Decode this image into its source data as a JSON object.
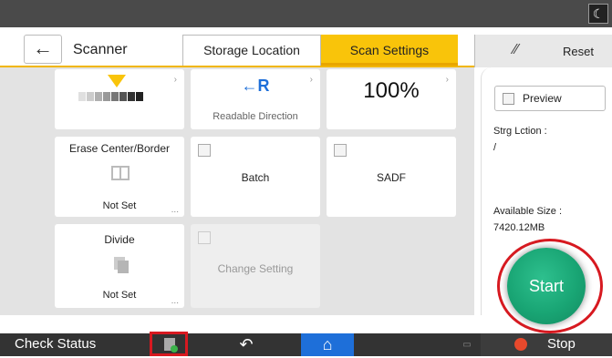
{
  "header": {
    "title": "Scanner",
    "back_icon": "←",
    "tabs": [
      {
        "label": "Storage Location",
        "active": false
      },
      {
        "label": "Scan Settings",
        "active": true
      }
    ],
    "reset_label": "Reset",
    "night_mode_icon": "☾"
  },
  "settings": {
    "density_chevron": "›",
    "readable_direction": {
      "icon_text": "←R",
      "label": "Readable Direction"
    },
    "scale": {
      "value": "100%"
    },
    "erase": {
      "label": "Erase Center/Border",
      "value": "Not Set"
    },
    "batch": {
      "label": "Batch"
    },
    "sadf": {
      "label": "SADF"
    },
    "divide": {
      "label": "Divide",
      "value": "Not Set"
    },
    "change_setting": {
      "label": "Change Setting"
    },
    "more_dots": "..."
  },
  "panel": {
    "preview_label": "Preview",
    "storage_location_label": "Strg Lction :",
    "storage_location_value": "/",
    "available_size_label": "Available Size :",
    "available_size_value": "7420.12MB",
    "start_label": "Start"
  },
  "bottom": {
    "check_status": "Check Status",
    "stop_label": "Stop"
  },
  "colors": {
    "accent_yellow": "#f9c40a",
    "start_green": "#19a574",
    "highlight_red": "#d71920",
    "home_blue": "#1e6fd9"
  }
}
